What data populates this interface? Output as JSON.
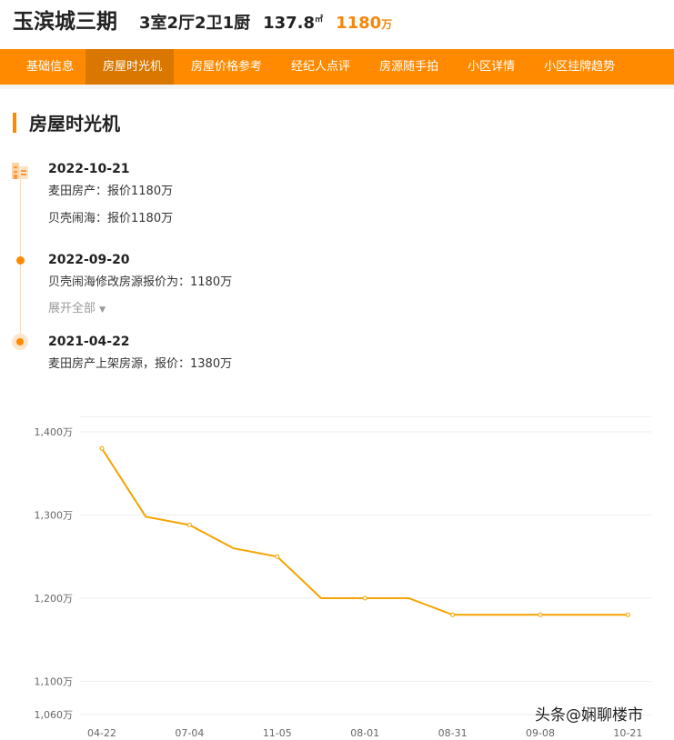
{
  "header": {
    "name": "玉滨城三期",
    "layout": "3室2厅2卫1厨",
    "area": "137.8",
    "area_unit": "㎡",
    "price": "1180",
    "price_unit": "万"
  },
  "nav": [
    "基础信息",
    "房屋时光机",
    "房屋价格参考",
    "经纪人点评",
    "房源随手拍",
    "小区详情",
    "小区挂牌趋势"
  ],
  "section_title": "房屋时光机",
  "timeline": [
    {
      "date": "2022-10-21",
      "lines": [
        "麦田房产：报价1180万",
        "贝壳闹海：报价1180万"
      ]
    },
    {
      "date": "2022-09-20",
      "lines": [
        "贝壳闹海修改房源报价为：1180万"
      ]
    },
    {
      "date": "2021-04-22",
      "lines": [
        "麦田房产上架房源，报价：1380万"
      ]
    }
  ],
  "expand_label": "展开全部",
  "watermark": "头条@娴聊楼市",
  "colors": {
    "accent": "#ff8a00",
    "line": "#f5a300"
  },
  "chart_data": {
    "type": "line",
    "categories": [
      "04-22",
      "",
      "07-04",
      "",
      "11-05",
      "",
      "08-01",
      "",
      "08-31",
      "",
      "09-08",
      "",
      "10-21"
    ],
    "values": [
      1380,
      1298,
      1288,
      1260,
      1250,
      1200,
      1200,
      1200,
      1180,
      1180,
      1180,
      1180,
      1180
    ],
    "yticks": [
      1060,
      1100,
      1200,
      1300,
      1400
    ],
    "ytick_labels": [
      "1,060万",
      "1,100万",
      "1,200万",
      "1,300万",
      "1,400万"
    ],
    "ylim": [
      1060,
      1418
    ],
    "grid": true
  }
}
